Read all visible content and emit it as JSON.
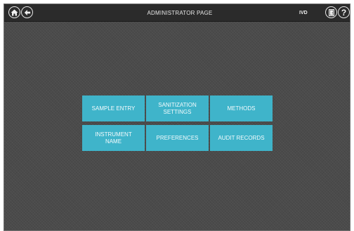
{
  "header": {
    "title": "ADMINISTRATOR PAGE",
    "badge": "IVD",
    "help_symbol": "?",
    "icons": {
      "home": "home-icon",
      "back": "back-arrow-icon",
      "logout": "door-exit-icon",
      "help": "help-icon"
    }
  },
  "menu": {
    "tiles": [
      {
        "label": "SAMPLE ENTRY"
      },
      {
        "label": "SANITIZATION SETTINGS"
      },
      {
        "label": "METHODS"
      },
      {
        "label": "INSTRUMENT NAME"
      },
      {
        "label": "PREFERENCES"
      },
      {
        "label": "AUDIT RECORDS"
      }
    ]
  },
  "colors": {
    "tile": "#3fb4ca",
    "background": "#4b4b4b",
    "topbar": "#2b2b2b"
  }
}
